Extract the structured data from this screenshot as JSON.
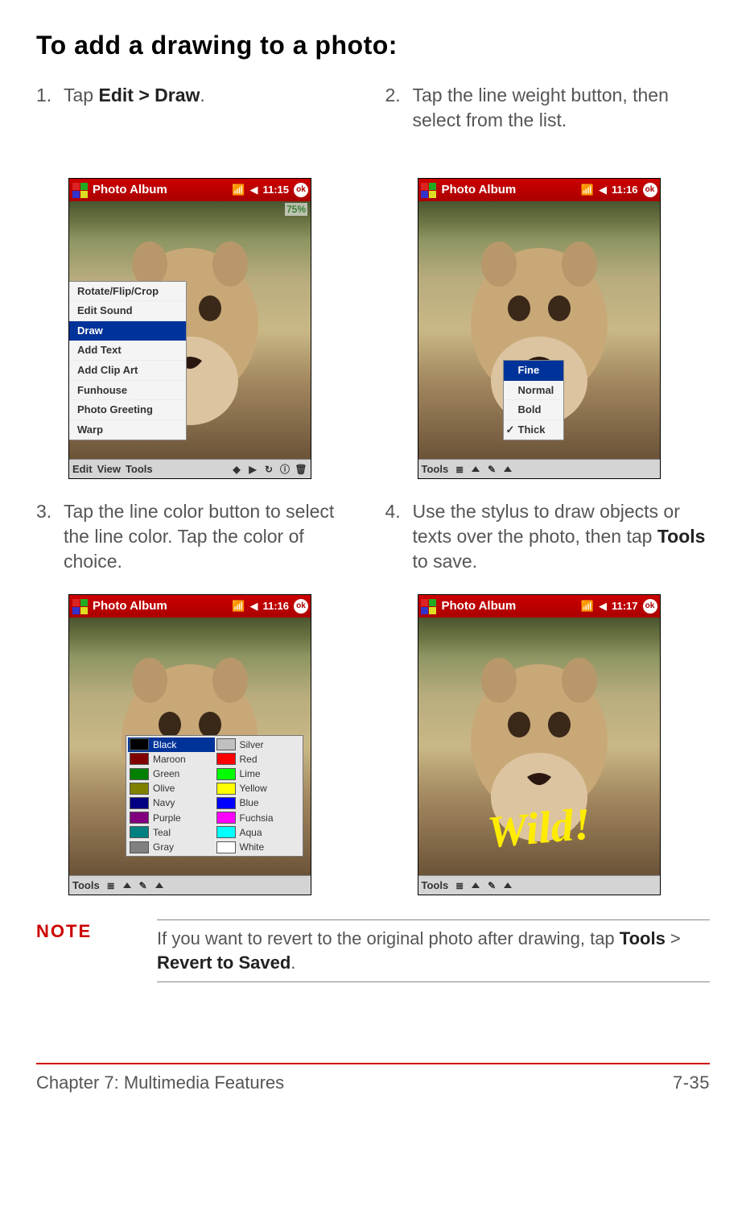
{
  "title": "To add a drawing to a photo:",
  "steps": {
    "s1": {
      "num": "1.",
      "pre": "Tap ",
      "bold": "Edit > Draw",
      "post": "."
    },
    "s2": {
      "num": "2.",
      "text": "Tap the line weight button, then select from the list."
    },
    "s3": {
      "num": "3.",
      "text": "Tap the line color button to select the line color. Tap the color of choice."
    },
    "s4": {
      "num": "4.",
      "pre": "Use the stylus to draw objects or texts over the photo, then tap ",
      "bold": "Tools",
      "post": " to save."
    }
  },
  "device": {
    "app_title": "Photo Album",
    "times": {
      "t1": "11:15",
      "t2": "11:16",
      "t3": "11:16",
      "t4": "11:17"
    },
    "ok": "ok",
    "percent": "75%",
    "edit_menu": [
      "Rotate/Flip/Crop",
      "Edit Sound",
      "Draw",
      "Add Text",
      "Add Clip Art",
      "Funhouse",
      "Photo Greeting",
      "Warp"
    ],
    "edit_selected": "Draw",
    "weight_menu": [
      "Fine",
      "Normal",
      "Bold",
      "Thick"
    ],
    "weight_selected": "Fine",
    "weight_checked": "Thick",
    "colors_left": [
      {
        "name": "Black",
        "hex": "#000000"
      },
      {
        "name": "Maroon",
        "hex": "#800000"
      },
      {
        "name": "Green",
        "hex": "#008000"
      },
      {
        "name": "Olive",
        "hex": "#808000"
      },
      {
        "name": "Navy",
        "hex": "#000080"
      },
      {
        "name": "Purple",
        "hex": "#800080"
      },
      {
        "name": "Teal",
        "hex": "#008080"
      },
      {
        "name": "Gray",
        "hex": "#808080"
      }
    ],
    "colors_right": [
      {
        "name": "Silver",
        "hex": "#c0c0c0"
      },
      {
        "name": "Red",
        "hex": "#ff0000"
      },
      {
        "name": "Lime",
        "hex": "#00ff00"
      },
      {
        "name": "Yellow",
        "hex": "#ffff00"
      },
      {
        "name": "Blue",
        "hex": "#0000ff"
      },
      {
        "name": "Fuchsia",
        "hex": "#ff00ff"
      },
      {
        "name": "Aqua",
        "hex": "#00ffff"
      },
      {
        "name": "White",
        "hex": "#ffffff"
      }
    ],
    "color_selected": "Black",
    "bottombar1": [
      "Edit",
      "View",
      "Tools"
    ],
    "bottombar_tools": "Tools",
    "wild": "Wild!"
  },
  "note": {
    "label": "NOTE",
    "pre": "If you want to revert to the original photo after drawing, tap ",
    "b1": "Tools",
    "mid": " > ",
    "b2": "Revert to Saved",
    "post": "."
  },
  "footer": {
    "chapter": "Chapter 7: Multimedia Features",
    "page": "7-35"
  }
}
